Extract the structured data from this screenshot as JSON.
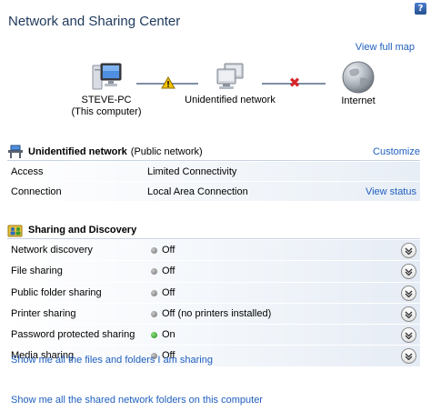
{
  "window": {
    "title": "Network and Sharing Center",
    "help_glyph": "?"
  },
  "map": {
    "view_full_map": "View full map",
    "computer_name": "STEVE-PC",
    "computer_sub": "(This computer)",
    "network_name": "Unidentified network",
    "internet": "Internet"
  },
  "network": {
    "name": "Unidentified network",
    "type": "(Public network)",
    "customize": "Customize",
    "rows": [
      {
        "label": "Access",
        "value": "Limited Connectivity",
        "action": ""
      },
      {
        "label": "Connection",
        "value": "Local Area Connection",
        "action": "View status"
      }
    ]
  },
  "sharing": {
    "title": "Sharing and Discovery",
    "rows": [
      {
        "label": "Network discovery",
        "state": "Off",
        "status": "off"
      },
      {
        "label": "File sharing",
        "state": "Off",
        "status": "off"
      },
      {
        "label": "Public folder sharing",
        "state": "Off",
        "status": "off"
      },
      {
        "label": "Printer sharing",
        "state": "Off (no printers installed)",
        "status": "off"
      },
      {
        "label": "Password protected sharing",
        "state": "On",
        "status": "on"
      },
      {
        "label": "Media sharing",
        "state": "Off",
        "status": "off"
      }
    ]
  },
  "links": {
    "files_folders": "Show me all the files and folders I am sharing",
    "shared_folders": "Show me all the shared network folders on this computer"
  },
  "colors": {
    "link": "#1f5fbf",
    "title": "#1e395b",
    "on_status": "#1f8b17",
    "off_status": "#6f6f6f",
    "error": "#d6252a",
    "warning": "#f2c200"
  }
}
